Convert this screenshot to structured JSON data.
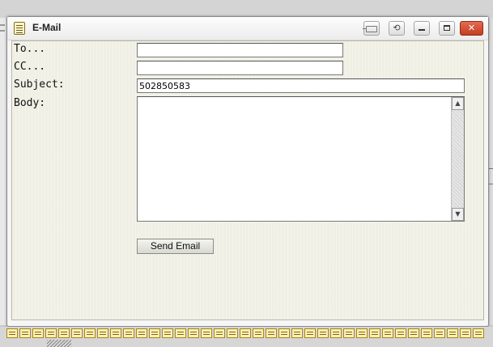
{
  "window": {
    "title": "E-Mail"
  },
  "titlebar_buttons": {
    "pin": "pin-icon",
    "refresh": "refresh-icon",
    "minimize": "minimize-icon",
    "maximize": "maximize-icon",
    "close": "close-icon",
    "close_glyph": "✕",
    "refresh_glyph": "⟲"
  },
  "form": {
    "to_label": "To...",
    "cc_label": "CC...",
    "subject_label": "Subject:",
    "body_label": "Body:",
    "to_value": "",
    "cc_value": "",
    "subject_value": "502850583",
    "body_value": "",
    "send_button": "Send Email"
  },
  "scrollbar": {
    "up_glyph": "▲",
    "down_glyph": "▼"
  },
  "colors": {
    "panel_background": "#efefe4",
    "close_button": "#c43b20"
  }
}
